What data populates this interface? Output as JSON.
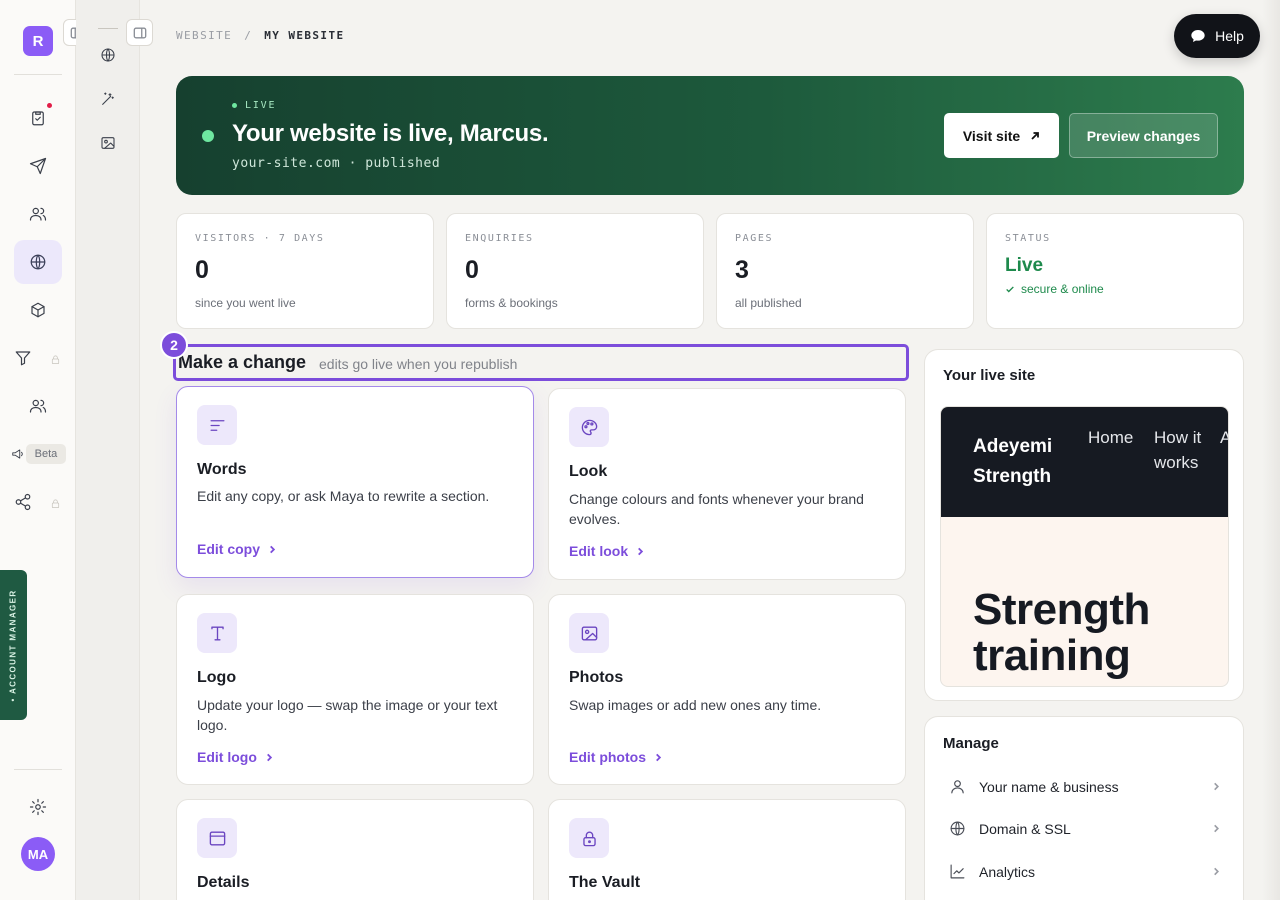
{
  "app": {
    "logo_letter": "R",
    "user_initials": "MA",
    "beta_label": "Beta",
    "account_manager_label": "• ACCOUNT MANAGER"
  },
  "breadcrumb": {
    "parent": "WEBSITE",
    "separator": "/",
    "current": "MY WEBSITE"
  },
  "help": {
    "label": "Help"
  },
  "hero": {
    "status": "LIVE",
    "title": "Your website is live, Marcus.",
    "subtitle": "your-site.com · published",
    "visit_label": "Visit site",
    "preview_label": "Preview changes"
  },
  "stats": [
    {
      "label": "VISITORS · 7 DAYS",
      "value": "0",
      "caption": "since you went live"
    },
    {
      "label": "ENQUIRIES",
      "value": "0",
      "caption": "forms & bookings"
    },
    {
      "label": "PAGES",
      "value": "3",
      "caption": "all published"
    },
    {
      "label": "STATUS",
      "value": "Live",
      "caption": "secure & online"
    }
  ],
  "make_change": {
    "step": "2",
    "title": "Make a change",
    "subtitle": "edits go live when you republish",
    "cards": [
      {
        "title": "Words",
        "desc": "Edit any copy, or ask Maya to rewrite a section.",
        "link": "Edit copy",
        "icon": "text-lines-icon"
      },
      {
        "title": "Look",
        "desc": "Change colours and fonts whenever your brand evolves.",
        "link": "Edit look",
        "icon": "palette-icon"
      },
      {
        "title": "Logo",
        "desc": "Update your logo — swap the image or your text logo.",
        "link": "Edit logo",
        "icon": "type-icon"
      },
      {
        "title": "Photos",
        "desc": "Swap images or add new ones any time.",
        "link": "Edit photos",
        "icon": "image-icon"
      },
      {
        "title": "Details",
        "icon": "window-icon"
      },
      {
        "title": "The Vault",
        "icon": "lock-icon"
      }
    ]
  },
  "live_site": {
    "title": "Your live site",
    "brand": "Adeyemi Strength",
    "nav": [
      "Home",
      "How it works",
      "A"
    ],
    "headline": "Strength training"
  },
  "manage": {
    "title": "Manage",
    "items": [
      {
        "label": "Your name & business",
        "icon": "person-icon"
      },
      {
        "label": "Domain & SSL",
        "icon": "globe-icon"
      },
      {
        "label": "Analytics",
        "icon": "chart-line-icon"
      }
    ]
  },
  "colors": {
    "accent": "#7c4ddb",
    "hero_green": "#1d5a3c",
    "live_green": "#1e8a4c",
    "logo": "#8b5cf6"
  }
}
